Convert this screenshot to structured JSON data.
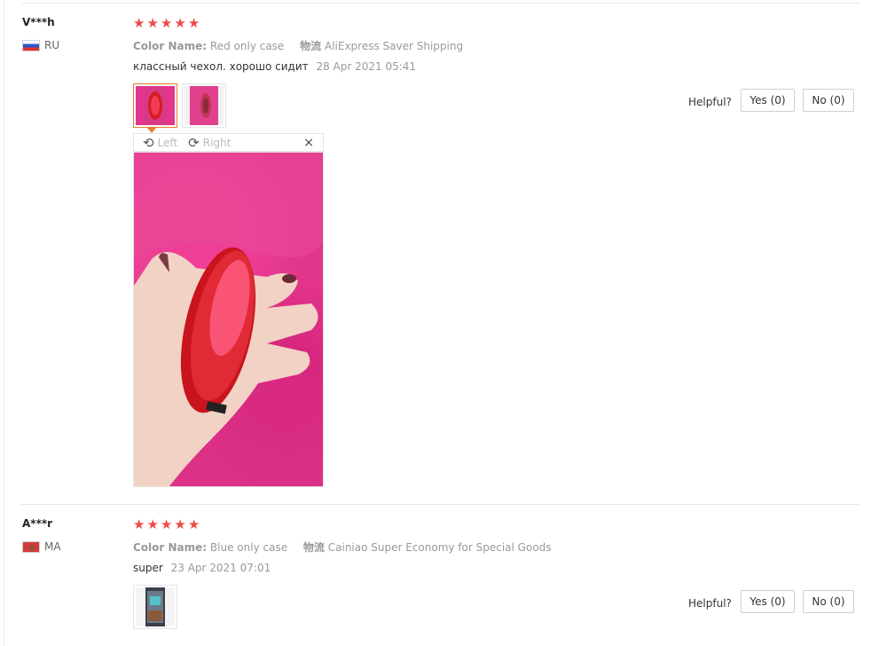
{
  "reviews": [
    {
      "user_name": "V***h",
      "country_code": "RU",
      "flag_icon": "flag-ru-icon",
      "rating": 5,
      "sku_key": "Color Name:",
      "sku_value": "Red only case",
      "logistics_key": "物流",
      "logistics_value": "AliExpress Saver Shipping",
      "text": "классный чехол. хорошо сидит",
      "date": "28 Apr 2021 05:41",
      "photo_count": 2,
      "viewer": {
        "rotate_left_label": "Left",
        "rotate_right_label": "Right",
        "close_glyph": "×"
      },
      "helpful_label": "Helpful?",
      "yes_label": "Yes (0)",
      "no_label": "No (0)"
    },
    {
      "user_name": "A***r",
      "country_code": "MA",
      "flag_icon": "flag-ma-icon",
      "rating": 5,
      "sku_key": "Color Name:",
      "sku_value": "Blue only case",
      "logistics_key": "物流",
      "logistics_value": "Cainiao Super Economy for Special Goods",
      "text": "super",
      "date": "23 Apr 2021 07:01",
      "photo_count": 1,
      "helpful_label": "Helpful?",
      "yes_label": "Yes (0)",
      "no_label": "No (0)"
    }
  ],
  "colors": {
    "star": "#ef4a48",
    "active_thumb_border": "#e0822a",
    "photo_pink": "#e2358c",
    "case_red": "#d81b24"
  }
}
